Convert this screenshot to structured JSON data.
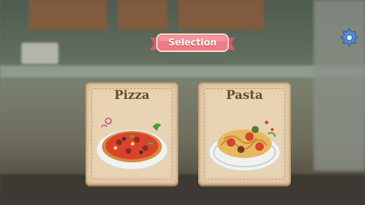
{
  "header": {
    "title": "Selection"
  },
  "options": [
    {
      "label": "Pizza",
      "dish_icon": "pizza-icon"
    },
    {
      "label": "Pasta",
      "dish_icon": "pasta-icon"
    }
  ],
  "toolbar": {
    "settings_icon": "gear-icon"
  },
  "colors": {
    "banner": "#f07b86",
    "card": "#e8d3b2",
    "title_text": "#6b4a2c"
  }
}
